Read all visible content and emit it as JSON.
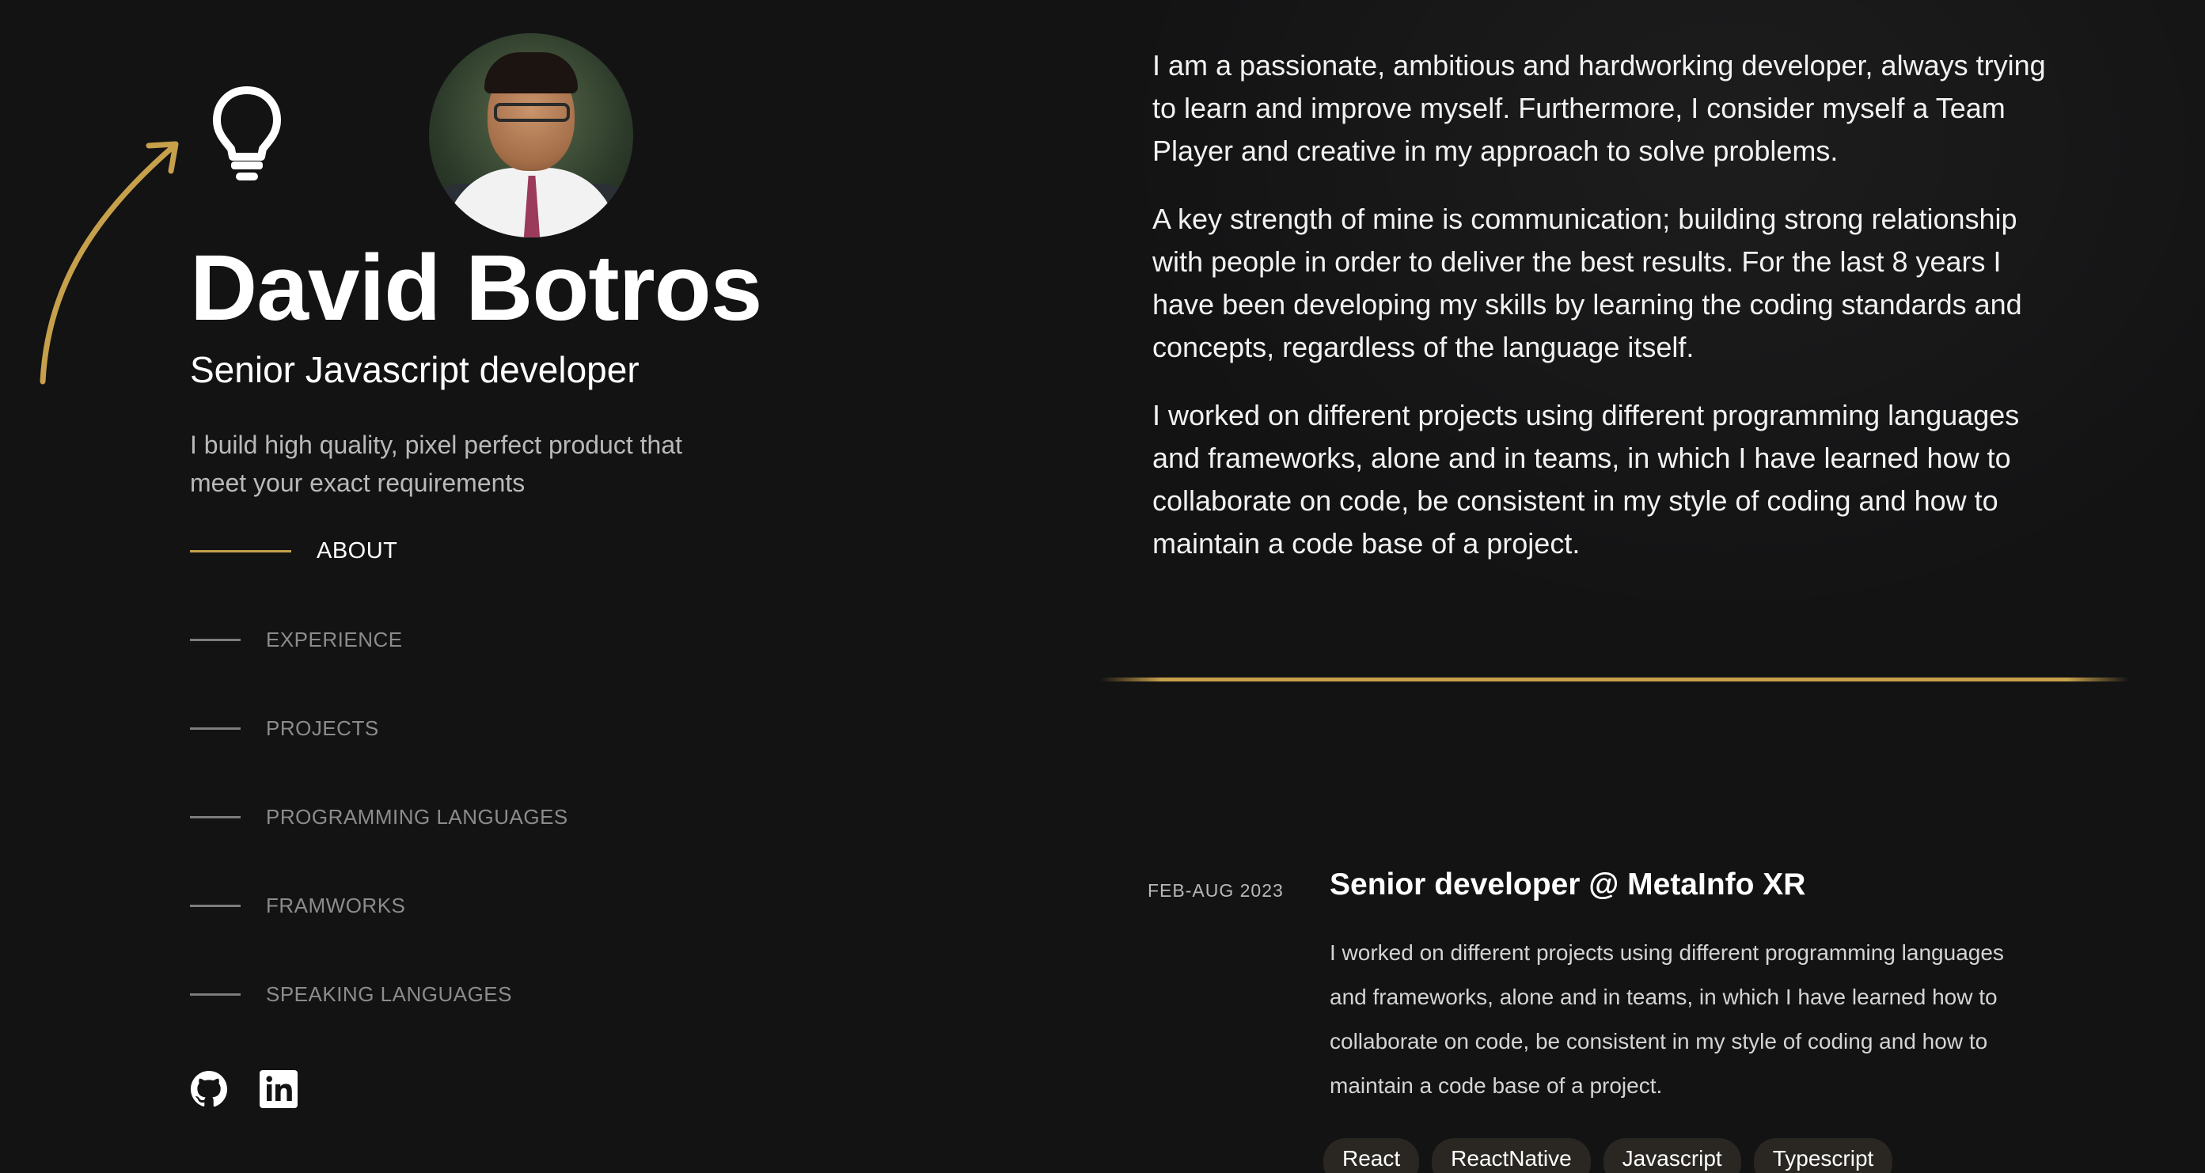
{
  "profile": {
    "name": "David Botros",
    "role": "Senior Javascript developer",
    "tagline": "I build high quality, pixel perfect product that meet your exact requirements"
  },
  "nav": {
    "items": [
      {
        "label": "ABOUT",
        "active": true
      },
      {
        "label": "EXPERIENCE",
        "active": false
      },
      {
        "label": "PROJECTS",
        "active": false
      },
      {
        "label": "PROGRAMMING LANGUAGES",
        "active": false
      },
      {
        "label": "FRAMWORKS",
        "active": false
      },
      {
        "label": "SPEAKING LANGUAGES",
        "active": false
      }
    ]
  },
  "social": {
    "icons": [
      "github-icon",
      "linkedin-icon"
    ]
  },
  "about": {
    "paragraphs": [
      "I am a passionate, ambitious and hardworking developer, always trying to learn and improve myself. Furthermore, I consider myself a Team Player and creative in my approach to solve problems.",
      "A key strength of mine is communication; building strong relationship with people in order to deliver the best results. For the last 8 years I have been developing my skills by learning the coding standards and concepts, regardless of the language itself.",
      "I worked on different projects using different programming languages and frameworks, alone and in teams, in which I have learned how to collaborate on code, be consistent in my style of coding and how to maintain a code base of a project."
    ]
  },
  "experience": [
    {
      "date": "FEB-AUG 2023",
      "title": "Senior developer @ MetaInfo XR",
      "description": "I worked on different projects using different programming languages and frameworks, alone and in teams, in which I have learned how to collaborate on code, be consistent in my style of coding and how to maintain a code base of a project.",
      "tags": [
        "React",
        "ReactNative",
        "Javascript",
        "Typescript"
      ]
    }
  ],
  "colors": {
    "background": "#131314",
    "accent": "#c7a04b",
    "muted": "#8c8c8c"
  }
}
